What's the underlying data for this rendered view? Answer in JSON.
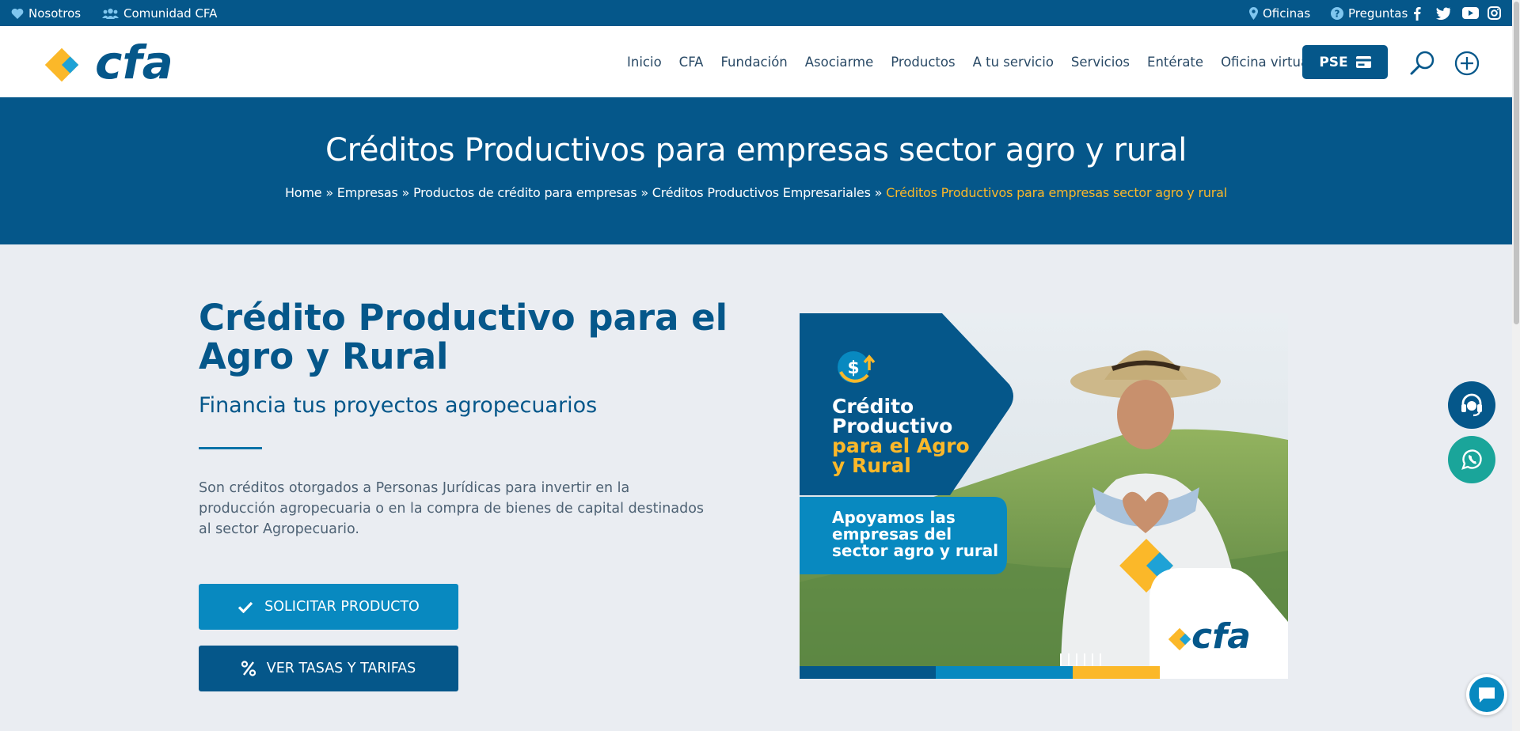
{
  "topbar": {
    "nosotros": "Nosotros",
    "comunidad": "Comunidad CFA",
    "oficinas": "Oficinas",
    "preguntas": "Preguntas",
    "social": [
      "facebook-icon",
      "twitter-icon",
      "youtube-icon",
      "instagram-icon"
    ]
  },
  "header": {
    "logo_text": "cfa",
    "nav": [
      "Inicio",
      "CFA",
      "Fundación",
      "Asociarme",
      "Productos",
      "A tu servicio",
      "Servicios",
      "Entérate",
      "Oficina virtual"
    ],
    "pse_label": "PSE"
  },
  "hero": {
    "title": "Créditos Productivos para empresas sector agro y rural",
    "breadcrumbs": [
      "Home",
      "Empresas",
      "Productos de crédito para empresas",
      "Créditos Productivos Empresariales"
    ],
    "separator": "»",
    "current": "Créditos Productivos para empresas sector agro y rural"
  },
  "main": {
    "title": "Crédito Productivo para el Agro y Rural",
    "subtitle": "Financia tus proyectos agropecuarios",
    "description": "Son créditos otorgados a Personas Jurídicas para invertir en la producción agropecuaria o en la compra de bienes de capital destinados al sector Agropecuario.",
    "btn_solicitar": "SOLICITAR PRODUCTO",
    "btn_tasas": "VER TASAS Y TARIFAS"
  },
  "promo": {
    "line1": "Crédito",
    "line2": "Productivo",
    "line3": "para el Agro",
    "line4": "y Rural",
    "sub1": "Apoyamos las",
    "sub2": "empresas del",
    "sub3": "sector agro y rural",
    "logo_text": "cfa"
  },
  "colors": {
    "primary": "#05578a",
    "accent": "#0889c0",
    "yellow": "#fbb829",
    "whatsapp": "#1aa59a"
  }
}
